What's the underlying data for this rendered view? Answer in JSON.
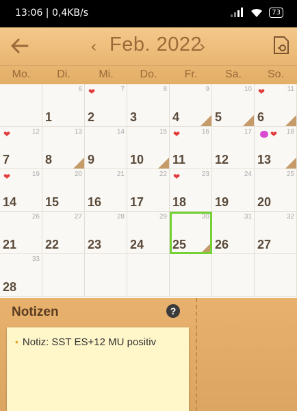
{
  "status_bar": {
    "time_speed": "13:06 | 0,4KB/s",
    "battery": "73"
  },
  "header": {
    "month": "Feb. 2022"
  },
  "weekdays": [
    "Mo.",
    "Di.",
    "Mi.",
    "Do.",
    "Fr.",
    "Sa.",
    "So."
  ],
  "calendar": {
    "cells": [
      {
        "day": "",
        "cycle": "",
        "heart": false,
        "fold": false
      },
      {
        "day": "1",
        "cycle": "6",
        "heart": false,
        "fold": false
      },
      {
        "day": "2",
        "cycle": "7",
        "heart": true,
        "fold": false
      },
      {
        "day": "3",
        "cycle": "8",
        "heart": false,
        "fold": false
      },
      {
        "day": "4",
        "cycle": "9",
        "heart": false,
        "fold": true
      },
      {
        "day": "5",
        "cycle": "10",
        "heart": false,
        "fold": true
      },
      {
        "day": "6",
        "cycle": "11",
        "heart": true,
        "fold": true
      },
      {
        "day": "7",
        "cycle": "12",
        "heart": true,
        "fold": false
      },
      {
        "day": "8",
        "cycle": "13",
        "heart": false,
        "fold": true
      },
      {
        "day": "9",
        "cycle": "14",
        "heart": false,
        "fold": false
      },
      {
        "day": "10",
        "cycle": "15",
        "heart": false,
        "fold": true
      },
      {
        "day": "11",
        "cycle": "16",
        "heart": true,
        "fold": false
      },
      {
        "day": "12",
        "cycle": "17",
        "heart": false,
        "fold": false
      },
      {
        "day": "13",
        "cycle": "18",
        "heart": true,
        "fold": true,
        "drop": true
      },
      {
        "day": "14",
        "cycle": "19",
        "heart": true,
        "fold": false
      },
      {
        "day": "15",
        "cycle": "20",
        "heart": false,
        "fold": false
      },
      {
        "day": "16",
        "cycle": "21",
        "heart": false,
        "fold": false
      },
      {
        "day": "17",
        "cycle": "22",
        "heart": false,
        "fold": false
      },
      {
        "day": "18",
        "cycle": "23",
        "heart": true,
        "fold": false
      },
      {
        "day": "19",
        "cycle": "24",
        "heart": false,
        "fold": false
      },
      {
        "day": "20",
        "cycle": "25",
        "heart": false,
        "fold": false
      },
      {
        "day": "21",
        "cycle": "26",
        "heart": false,
        "fold": false
      },
      {
        "day": "22",
        "cycle": "27",
        "heart": false,
        "fold": false
      },
      {
        "day": "23",
        "cycle": "28",
        "heart": false,
        "fold": false
      },
      {
        "day": "24",
        "cycle": "29",
        "heart": false,
        "fold": false
      },
      {
        "day": "25",
        "cycle": "30",
        "heart": false,
        "fold": true,
        "today": true
      },
      {
        "day": "26",
        "cycle": "31",
        "heart": false,
        "fold": false
      },
      {
        "day": "27",
        "cycle": "32",
        "heart": false,
        "fold": false
      },
      {
        "day": "28",
        "cycle": "33",
        "heart": false,
        "fold": false
      },
      {
        "day": "",
        "cycle": "",
        "heart": false,
        "fold": false
      },
      {
        "day": "",
        "cycle": "",
        "heart": false,
        "fold": false
      },
      {
        "day": "",
        "cycle": "",
        "heart": false,
        "fold": false
      },
      {
        "day": "",
        "cycle": "",
        "heart": false,
        "fold": false
      },
      {
        "day": "",
        "cycle": "",
        "heart": false,
        "fold": false
      },
      {
        "day": "",
        "cycle": "",
        "heart": false,
        "fold": false
      }
    ]
  },
  "notes": {
    "title": "Notizen",
    "help": "?",
    "items": [
      "Notiz:  SST ES+12 MU positiv"
    ]
  },
  "colors": {
    "today_border": "#74d235",
    "heart": "#e03a3a",
    "header_text": "#9b6a38"
  },
  "icons": [
    "signal-icon",
    "wifi-icon",
    "battery-icon",
    "back-arrow-icon",
    "calendar-settings-icon",
    "help-icon",
    "heart-icon"
  ]
}
